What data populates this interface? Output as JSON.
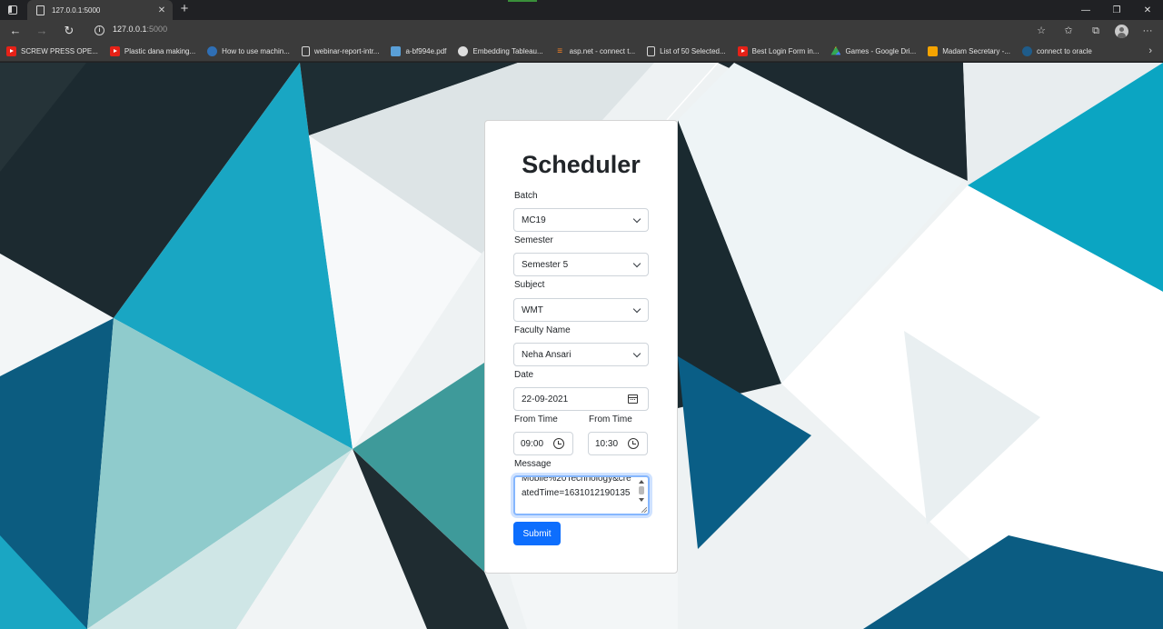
{
  "browser": {
    "tab_title": "127.0.0.1:5000",
    "tab_close": "✕",
    "new_tab": "+",
    "url_host": "127.0.0.1",
    "url_port": ":5000",
    "window_controls": [
      "—",
      "❐",
      "✕"
    ],
    "nav": {
      "back": "←",
      "forward": "→",
      "refresh": "↻"
    },
    "toolbar_icons": [
      "read-aloud-icon",
      "favorites-icon",
      "collections-icon",
      "profile-icon",
      "more-icon"
    ],
    "more_glyph": "···",
    "bookmarks": [
      {
        "label": "SCREW PRESS OPE...",
        "icon": "youtube"
      },
      {
        "label": "Plastic dana making...",
        "icon": "youtube"
      },
      {
        "label": "How to use machin...",
        "icon": "blue"
      },
      {
        "label": "webinar-report-intr...",
        "icon": "doc"
      },
      {
        "label": "a-bf994e.pdf",
        "icon": "img"
      },
      {
        "label": "Embedding Tableau...",
        "icon": "wp"
      },
      {
        "label": "asp.net - connect t...",
        "icon": "so"
      },
      {
        "label": "List of 50 Selected...",
        "icon": "doc"
      },
      {
        "label": "Best Login Form in...",
        "icon": "youtube"
      },
      {
        "label": "Games - Google Dri...",
        "icon": "gd"
      },
      {
        "label": "Madam Secretary -...",
        "icon": "m"
      },
      {
        "label": "connect to oracle",
        "icon": "ora"
      }
    ],
    "bookmarks_more": "›"
  },
  "form": {
    "title": "Scheduler",
    "batch_label": "Batch",
    "batch_value": "MC19",
    "semester_label": "Semester",
    "semester_value": "Semester 5",
    "subject_label": "Subject",
    "subject_value": "WMT",
    "faculty_label": "Faculty Name",
    "faculty_value": "Neha Ansari",
    "date_label": "Date",
    "date_value": "22-09-2021",
    "from_time_label": "From Time",
    "from_time_value": "09:00",
    "to_time_label": "From Time",
    "to_time_value": "10:30",
    "message_label": "Message",
    "message_value": "Mobile%20Technology&createdTime=1631012190135",
    "submit_label": "Submit"
  }
}
